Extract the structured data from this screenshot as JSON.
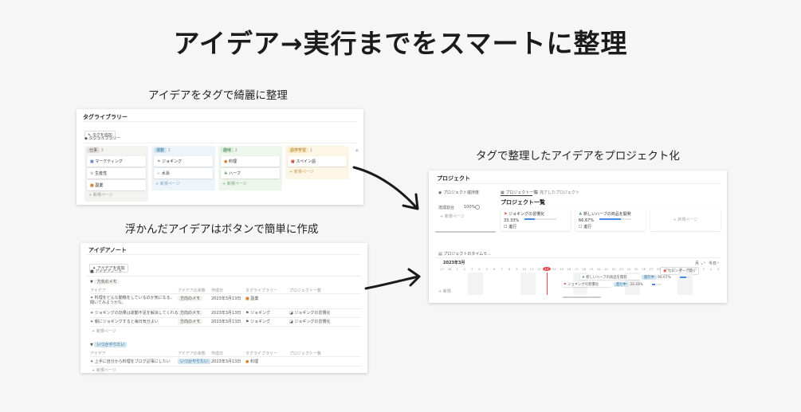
{
  "headline": "アイデア→実行までをスマートに整理",
  "captions": {
    "tag_panel": "アイデアをタグで綺麗に整理",
    "note_panel": "浮かんだアイデアはボタンで簡単に作成",
    "project_panel": "タグで整理したアイデアをプロジェクト化"
  },
  "tag_library": {
    "title": "タグライブラリー",
    "add_button": "タグを追加",
    "view_label": "タグライブラリー",
    "add_column": "+",
    "new_page": "+ 新規ページ",
    "columns": [
      {
        "label": "仕事",
        "count": "3",
        "color": "#e3e2e0",
        "text_color": "#555",
        "cards": [
          "マーケティング",
          "生産性",
          "副業"
        ],
        "card_colors": [
          "#6a8fd4",
          "#9aa0a6",
          "#d9822b"
        ]
      },
      {
        "label": "運動",
        "count": "2",
        "color": "#d3e5ef",
        "text_color": "#2f6f9a",
        "cards": [
          "ジョギング",
          "水泳"
        ],
        "card_colors": [
          "#9aa0a6",
          "#9aa0a6"
        ]
      },
      {
        "label": "趣味",
        "count": "2",
        "color": "#dbeddb",
        "text_color": "#3c7a45",
        "cards": [
          "料理",
          "ハーブ"
        ],
        "card_colors": [
          "#d9822b",
          "#6aa36f"
        ]
      },
      {
        "label": "語学学習",
        "count": "1",
        "color": "#fdecc8",
        "text_color": "#9c6b13",
        "cards": [
          "スペイン語"
        ],
        "card_colors": [
          "#d05a4a"
        ]
      }
    ]
  },
  "idea_note": {
    "title": "アイデアノート",
    "add_button": "アイデアを追加",
    "view_label": "アイデアノート",
    "new_page": "+ 新規ページ",
    "columns": [
      "アイデア",
      "アイデアの状態",
      "作成日",
      "タグライブラリー",
      "プロジェクト一覧"
    ],
    "groups": [
      {
        "label": "方向のメモ",
        "label_color": "#f1f1ef",
        "rows": [
          {
            "idea": "料理をどんな動機をしているのか気になる。聞いてみようかな。",
            "status": "方向のメモ",
            "date": "2023年3月13日",
            "tag": "副業",
            "project": ""
          },
          {
            "idea": "ジョギングの効果は運動不足を解消してくれる",
            "status": "方向のメモ",
            "date": "2023年3月13日",
            "tag": "ジョギング",
            "project": "ジョギングの習慣化"
          },
          {
            "idea": "朝にジョギングすると毎日気分よい",
            "status": "方向のメモ",
            "date": "2023年3月13日",
            "tag": "ジョギング",
            "project": "ジョギングの習慣化"
          }
        ]
      },
      {
        "label": "いつかやりたい",
        "label_color": "#d3e5ef",
        "rows": [
          {
            "idea": "上手に自分から料理をブログ記事にしたい",
            "status": "いつかやりたい",
            "date": "2023年3月13日",
            "tag": "料理",
            "project": ""
          }
        ]
      }
    ]
  },
  "project": {
    "title": "プロジェクト",
    "side_title": "プロジェクト進捗度",
    "side_label": "達成割合",
    "side_value": "100%",
    "side_new": "+ 新規ページ",
    "tabs": [
      "プロジェクト一覧",
      "完了したプロジェクト"
    ],
    "heading": "プロジェクト一覧",
    "cards": [
      {
        "name": "ジョギングの習慣化",
        "progress": "33.33%",
        "progress_frac": 0.33,
        "checkbox": "進行"
      },
      {
        "name": "新しいハーブの商品を開発",
        "progress": "66.67%",
        "progress_frac": 0.67,
        "checkbox": "進行"
      }
    ],
    "new_page": "+ 新規ページ",
    "timeline_title": "プロジェクトのタイムラ...",
    "timeline_month": "2023年3月",
    "timeline_open_calendar": "カレンダーで開く",
    "timeline_unit": "月",
    "timeline_today": "今日",
    "timeline_days": [
      "27",
      "28",
      "1",
      "2",
      "3",
      "4",
      "5",
      "6",
      "7",
      "8",
      "9",
      "10",
      "11",
      "12",
      "13",
      "14",
      "15",
      "16",
      "17",
      "18",
      "19",
      "20",
      "21",
      "22",
      "23",
      "24",
      "25",
      "26",
      "27",
      "28",
      "29",
      "30",
      "31",
      "1",
      "2",
      "3",
      "4",
      "5"
    ],
    "timeline_today_day": "13",
    "timeline_items": [
      {
        "name": "新しいハーブの商品を開発",
        "status": "進行中",
        "progress": "66.67%",
        "progress_frac": 0.67
      },
      {
        "name": "ジョギングの習慣化",
        "status": "進行中",
        "progress": "33.33%",
        "progress_frac": 0.33
      }
    ],
    "timeline_new": "+ 新規"
  },
  "colors": {
    "accent_red": "#e5484d",
    "progress_blue": "#4b8be8"
  }
}
